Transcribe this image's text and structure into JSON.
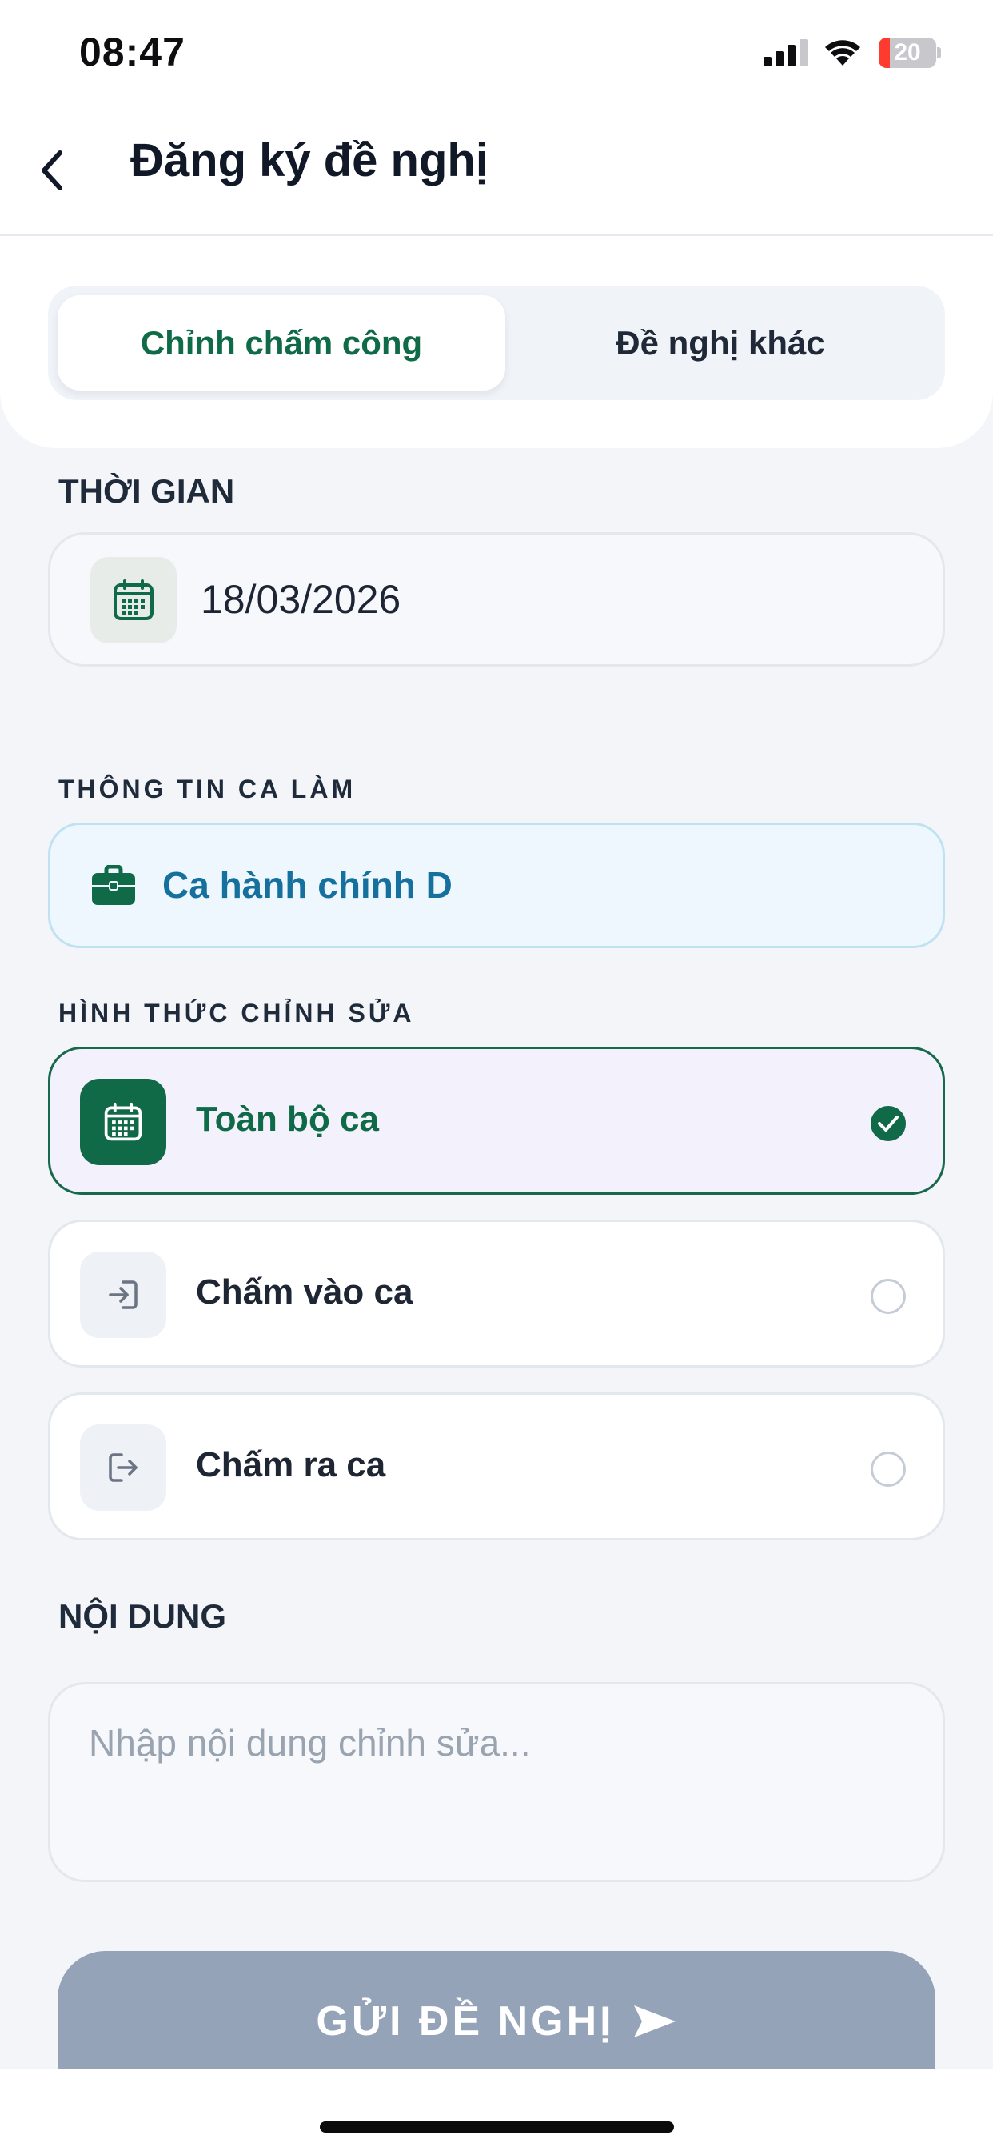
{
  "status_bar": {
    "time": "08:47",
    "battery_level": "20",
    "battery_fraction": 0.2,
    "battery_color": "#ff3b30",
    "signal_icon": "cellular-signal-icon",
    "wifi_icon": "wifi-icon"
  },
  "header": {
    "title": "Đăng ký đề nghị",
    "back_icon": "chevron-left-icon"
  },
  "tabs": {
    "items": [
      {
        "label": "Chỉnh chấm công",
        "active": true
      },
      {
        "label": "Đề nghị khác",
        "active": false
      }
    ]
  },
  "time_section": {
    "label": "THỜI GIAN",
    "date_value": "18/03/2026",
    "icon": "calendar-icon"
  },
  "shift_section": {
    "label": "THÔNG TIN CA LÀM",
    "shift_name": "Ca hành chính D",
    "icon": "briefcase-icon"
  },
  "mode_section": {
    "label": "HÌNH THỨC CHỈNH SỬA",
    "options": [
      {
        "label": "Toàn bộ ca",
        "icon": "calendar-icon",
        "selected": true
      },
      {
        "label": "Chấm vào ca",
        "icon": "login-icon",
        "selected": false
      },
      {
        "label": "Chấm ra ca",
        "icon": "logout-icon",
        "selected": false
      }
    ]
  },
  "content_section": {
    "label": "NỘI DUNG",
    "value": "",
    "placeholder": "Nhập nội dung chỉnh sửa..."
  },
  "submit": {
    "label": "GỬI ĐỀ NGHỊ",
    "icon": "send-icon",
    "color": "#95a3b8"
  },
  "colors": {
    "brand_green": "#116a47",
    "shift_blue": "#16709e"
  }
}
